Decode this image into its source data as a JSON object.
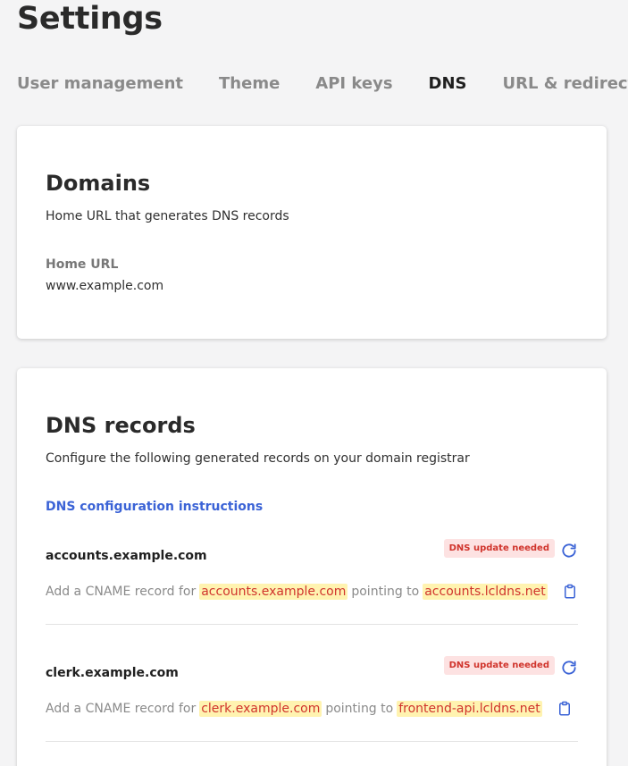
{
  "page": {
    "title": "Settings"
  },
  "tabs": [
    {
      "label": "User management"
    },
    {
      "label": "Theme"
    },
    {
      "label": "API keys"
    },
    {
      "label": "DNS"
    },
    {
      "label": "URL & redirects"
    }
  ],
  "active_tab": "DNS",
  "domains": {
    "title": "Domains",
    "subtitle": "Home URL that generates DNS records",
    "home_url_label": "Home URL",
    "home_url_value": "www.example.com"
  },
  "dns_records": {
    "title": "DNS records",
    "subtitle": "Configure the following generated records on your domain registrar",
    "instructions_link": "DNS configuration instructions",
    "records": [
      {
        "name": "accounts.example.com",
        "status": "DNS update needed",
        "prefix": "Add a CNAME record for",
        "host": "accounts.example.com",
        "middle": "pointing to",
        "target": "accounts.lcldns.net"
      },
      {
        "name": "clerk.example.com",
        "status": "DNS update needed",
        "prefix": "Add a CNAME record for",
        "host": "clerk.example.com",
        "middle": "pointing to",
        "target": "frontend-api.lcldns.net"
      }
    ]
  },
  "colors": {
    "link": "#3b63d6",
    "badge_bg": "#fde2e2",
    "badge_text": "#d0342c",
    "highlight_bg": "#fff3b0",
    "refresh_icon": "#3b63d6"
  },
  "icons": {
    "refresh": "refresh-icon",
    "copy": "clipboard-icon"
  }
}
